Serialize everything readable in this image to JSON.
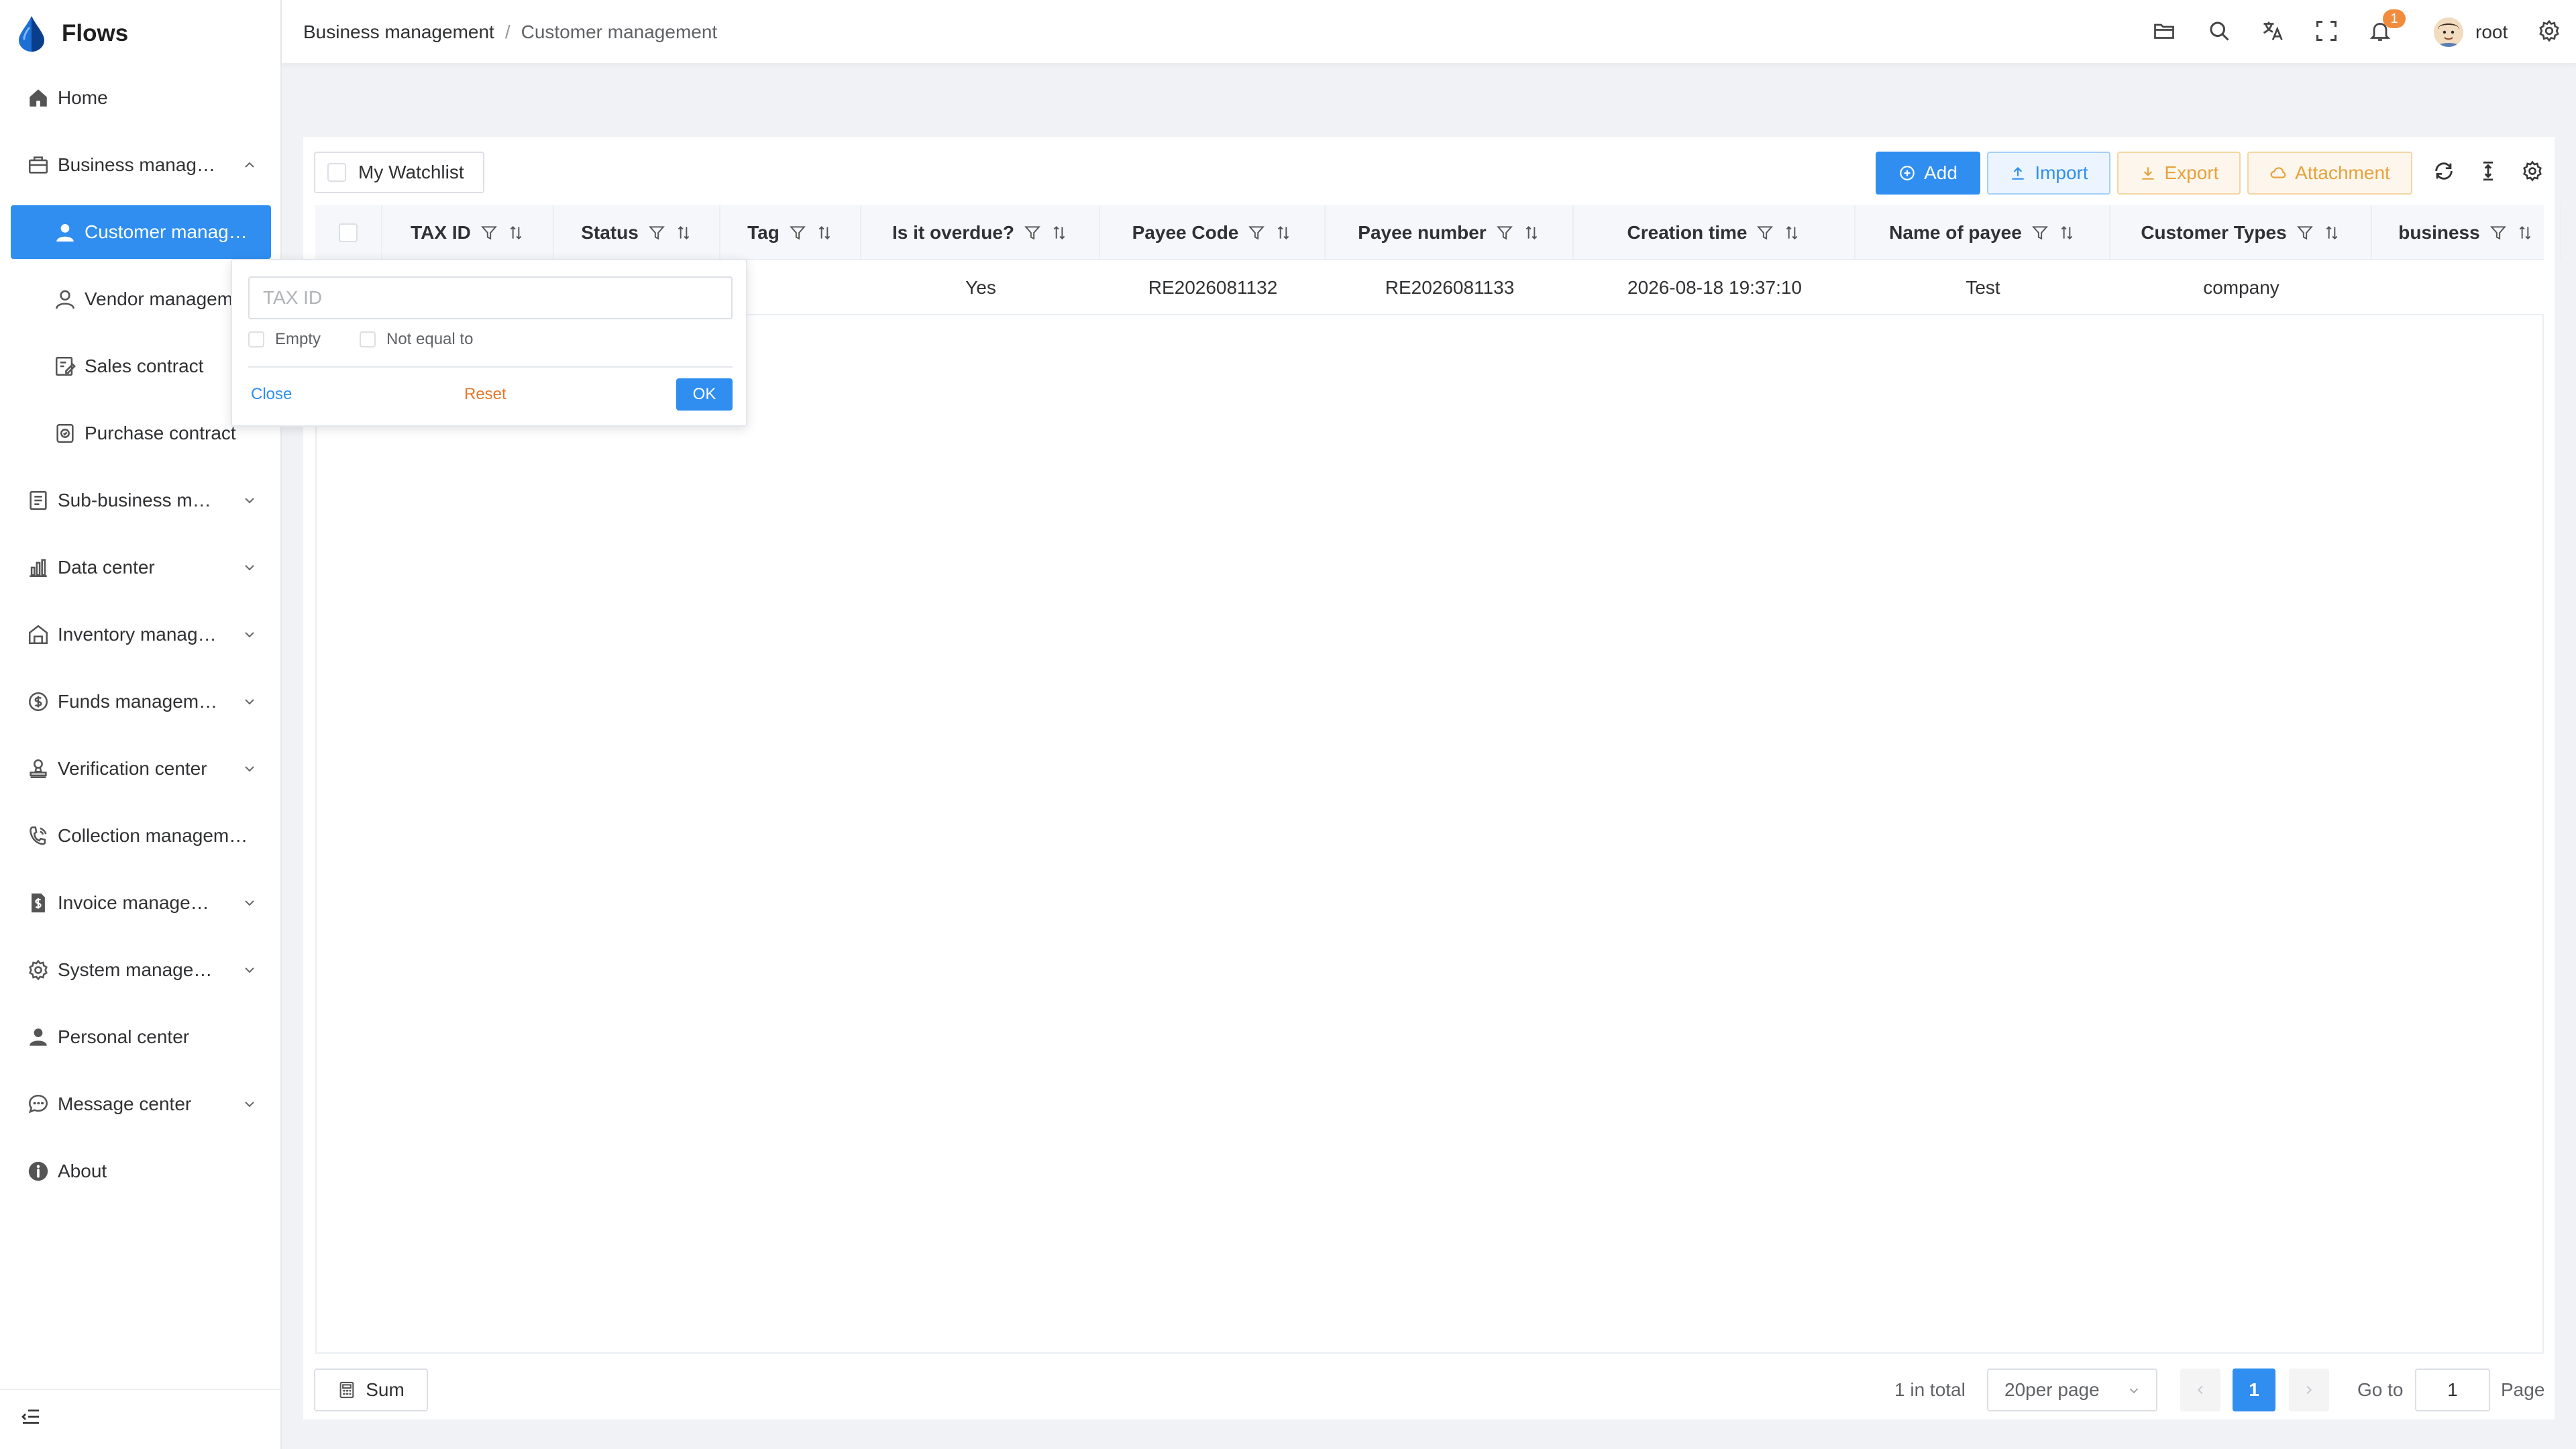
{
  "app": {
    "name": "Flows"
  },
  "sidebar": {
    "items": [
      {
        "label": "Home"
      },
      {
        "label": "Business manag…"
      },
      {
        "label": "Customer manag…"
      },
      {
        "label": "Vendor managem"
      },
      {
        "label": "Sales contract"
      },
      {
        "label": "Purchase contract"
      },
      {
        "label": "Sub-business m…"
      },
      {
        "label": "Data center"
      },
      {
        "label": "Inventory manag…"
      },
      {
        "label": "Funds managem…"
      },
      {
        "label": "Verification center"
      },
      {
        "label": "Collection managem…"
      },
      {
        "label": "Invoice manage…"
      },
      {
        "label": "System manage…"
      },
      {
        "label": "Personal center"
      },
      {
        "label": "Message center"
      },
      {
        "label": "About"
      }
    ]
  },
  "header": {
    "breadcrumb": [
      "Business management",
      "Customer management"
    ],
    "breadcrumb_sep": "/",
    "notification_count": "1",
    "username": "root"
  },
  "toolbar": {
    "watchlist_label": "My Watchlist",
    "add_label": "Add",
    "import_label": "Import",
    "export_label": "Export",
    "attachment_label": "Attachment"
  },
  "table": {
    "columns": [
      "TAX ID",
      "Status",
      "Tag",
      "Is it overdue?",
      "Payee Code",
      "Payee number",
      "Creation time",
      "Name of payee",
      "Customer Types",
      "business"
    ],
    "rows": [
      {
        "is_overdue": "Yes",
        "payee_code": "RE2026081132",
        "payee_number": "RE2026081133",
        "creation_time": "2026-08-18 19:37:10",
        "name_of_payee": "Test",
        "customer_type": "company"
      }
    ]
  },
  "filter_popover": {
    "placeholder": "TAX ID",
    "option_empty": "Empty",
    "option_not_equal": "Not equal to",
    "close_label": "Close",
    "reset_label": "Reset",
    "ok_label": "OK"
  },
  "footer": {
    "sum_label": "Sum",
    "total_text": "1 in total",
    "page_size": "20per page",
    "current_page": "1",
    "goto_label": "Go to",
    "goto_value": "1",
    "page_label": "Page"
  },
  "colors": {
    "accent": "#2f8ef0",
    "warning": "#e6a23c",
    "badge": "#f28c3c"
  }
}
